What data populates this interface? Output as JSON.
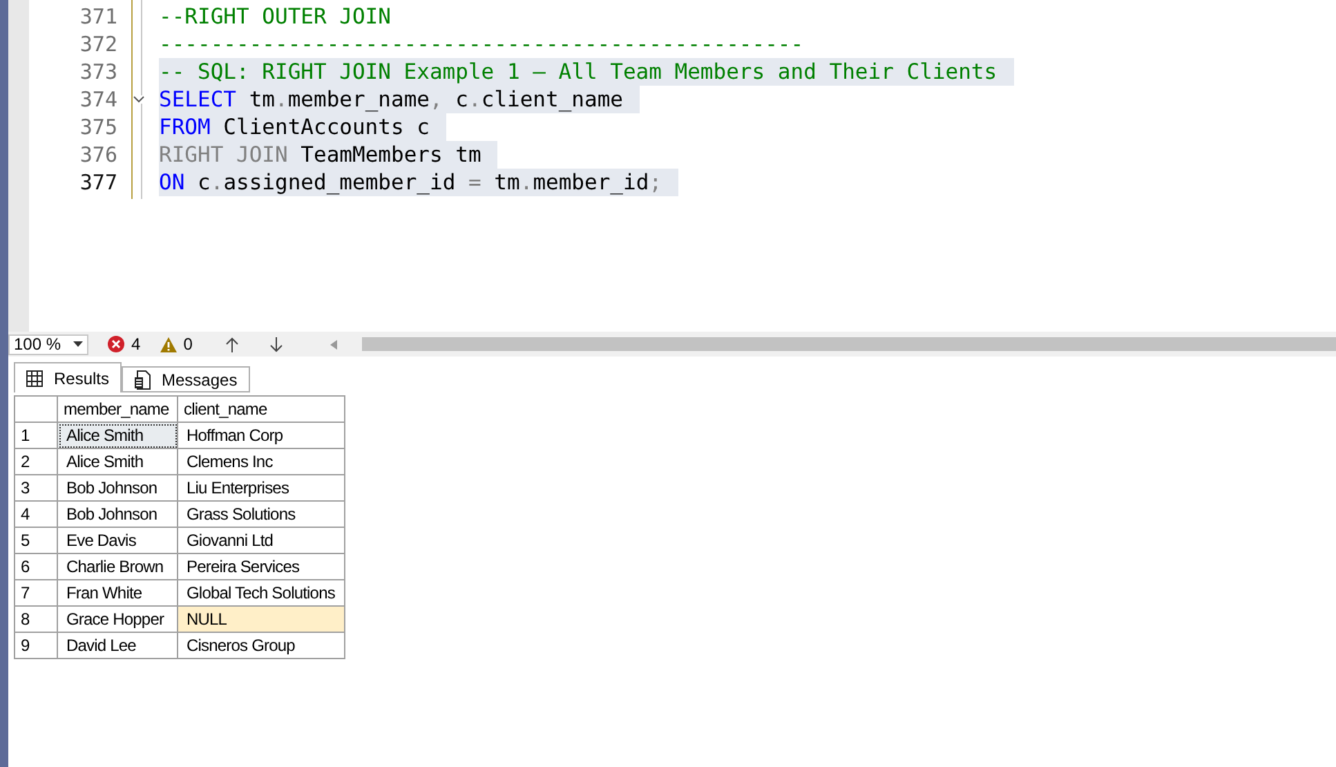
{
  "editor": {
    "lines": [
      {
        "number": "371",
        "current": false,
        "selected": false,
        "foldable": false,
        "tokens": [
          {
            "kind": "comment",
            "text": "--RIGHT OUTER JOIN"
          }
        ]
      },
      {
        "number": "372",
        "current": false,
        "selected": false,
        "foldable": false,
        "tokens": [
          {
            "kind": "comment",
            "text": "--------------------------------------------------"
          }
        ]
      },
      {
        "number": "373",
        "current": false,
        "selected": true,
        "foldable": false,
        "tokens": [
          {
            "kind": "comment",
            "text": "-- SQL: RIGHT JOIN Example 1 – All Team Members and Their Clients"
          }
        ]
      },
      {
        "number": "374",
        "current": false,
        "selected": true,
        "foldable": true,
        "tokens": [
          {
            "kind": "keyword",
            "text": "SELECT"
          },
          {
            "kind": "plain",
            "text": " tm"
          },
          {
            "kind": "gray",
            "text": "."
          },
          {
            "kind": "plain",
            "text": "member_name"
          },
          {
            "kind": "gray",
            "text": ","
          },
          {
            "kind": "plain",
            "text": " c"
          },
          {
            "kind": "gray",
            "text": "."
          },
          {
            "kind": "plain",
            "text": "client_name"
          }
        ]
      },
      {
        "number": "375",
        "current": false,
        "selected": true,
        "foldable": false,
        "tokens": [
          {
            "kind": "keyword",
            "text": "FROM"
          },
          {
            "kind": "plain",
            "text": " ClientAccounts c"
          }
        ]
      },
      {
        "number": "376",
        "current": false,
        "selected": true,
        "foldable": false,
        "tokens": [
          {
            "kind": "gray",
            "text": "RIGHT JOIN"
          },
          {
            "kind": "plain",
            "text": " TeamMembers tm"
          }
        ]
      },
      {
        "number": "377",
        "current": true,
        "selected": true,
        "foldable": false,
        "tokens": [
          {
            "kind": "keyword",
            "text": "ON"
          },
          {
            "kind": "plain",
            "text": " c"
          },
          {
            "kind": "gray",
            "text": "."
          },
          {
            "kind": "plain",
            "text": "assigned_member_id "
          },
          {
            "kind": "gray",
            "text": "="
          },
          {
            "kind": "plain",
            "text": " tm"
          },
          {
            "kind": "gray",
            "text": "."
          },
          {
            "kind": "plain",
            "text": "member_id"
          },
          {
            "kind": "gray",
            "text": ";"
          }
        ]
      }
    ]
  },
  "status": {
    "zoom": "100 %",
    "errors": "4",
    "warnings": "0"
  },
  "tabs": [
    {
      "label": "Results",
      "selected": true
    },
    {
      "label": "Messages",
      "selected": false
    }
  ],
  "grid": {
    "columns": [
      "member_name",
      "client_name"
    ],
    "rows": [
      {
        "number": "1",
        "cells": [
          {
            "text": "Alice Smith",
            "selected": true,
            "is_null": false
          },
          {
            "text": "Hoffman Corp",
            "selected": false,
            "is_null": false
          }
        ]
      },
      {
        "number": "2",
        "cells": [
          {
            "text": "Alice Smith",
            "selected": false,
            "is_null": false
          },
          {
            "text": "Clemens Inc",
            "selected": false,
            "is_null": false
          }
        ]
      },
      {
        "number": "3",
        "cells": [
          {
            "text": "Bob Johnson",
            "selected": false,
            "is_null": false
          },
          {
            "text": "Liu Enterprises",
            "selected": false,
            "is_null": false
          }
        ]
      },
      {
        "number": "4",
        "cells": [
          {
            "text": "Bob Johnson",
            "selected": false,
            "is_null": false
          },
          {
            "text": "Grass Solutions",
            "selected": false,
            "is_null": false
          }
        ]
      },
      {
        "number": "5",
        "cells": [
          {
            "text": "Eve Davis",
            "selected": false,
            "is_null": false
          },
          {
            "text": "Giovanni Ltd",
            "selected": false,
            "is_null": false
          }
        ]
      },
      {
        "number": "6",
        "cells": [
          {
            "text": "Charlie Brown",
            "selected": false,
            "is_null": false
          },
          {
            "text": "Pereira Services",
            "selected": false,
            "is_null": false
          }
        ]
      },
      {
        "number": "7",
        "cells": [
          {
            "text": "Fran White",
            "selected": false,
            "is_null": false
          },
          {
            "text": "Global Tech Solutions",
            "selected": false,
            "is_null": false
          }
        ]
      },
      {
        "number": "8",
        "cells": [
          {
            "text": "Grace Hopper",
            "selected": false,
            "is_null": false
          },
          {
            "text": "NULL",
            "selected": false,
            "is_null": true
          }
        ]
      },
      {
        "number": "9",
        "cells": [
          {
            "text": "David Lee",
            "selected": false,
            "is_null": false
          },
          {
            "text": "Cisneros Group",
            "selected": false,
            "is_null": false
          }
        ]
      }
    ]
  }
}
